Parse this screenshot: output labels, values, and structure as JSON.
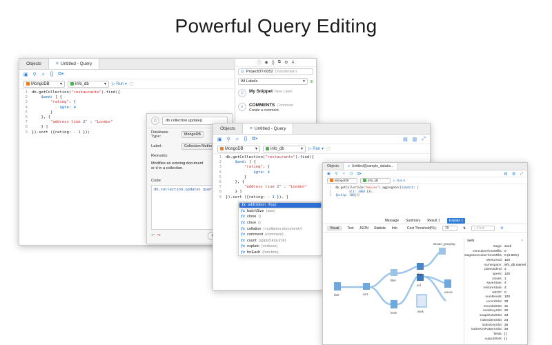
{
  "headline": "Powerful Query Editing",
  "win1": {
    "tabs": [
      "Objects",
      "Untitled - Query"
    ],
    "db_type": "MongoDB",
    "db_name": "info_db",
    "run": "Run",
    "code": [
      {
        "n": "1",
        "t": "db.getCollection(\"restaurants\").find({"
      },
      {
        "n": "2",
        "t": "    $and: [ {"
      },
      {
        "n": "3",
        "t": "        \"rating\": {"
      },
      {
        "n": "4",
        "t": "            $gte: 4"
      },
      {
        "n": "5",
        "t": "        }"
      },
      {
        "n": "6",
        "t": "    }, {"
      },
      {
        "n": "7",
        "t": "        \"address line 2\" : \"London\""
      },
      {
        "n": "8",
        "t": "    } ]"
      },
      {
        "n": "9",
        "t": "}).sort ({rating: - 1 });"
      }
    ],
    "side": {
      "project": "ProjectDT-0052",
      "project_user": "(marybrown)",
      "labels": "All Labels",
      "snippets": [
        {
          "title": "My Snippet",
          "sub": "New Label",
          "desc": ""
        },
        {
          "title": "COMMENTS",
          "sub": "Comment",
          "desc": "Create a comment."
        }
      ]
    }
  },
  "dialog": {
    "title": "db.collection.update()",
    "db_type_label": "Database Type:",
    "db_type": "MongoDB",
    "label_label": "Label:",
    "label": "Collection Metho",
    "remarks_label": "Remarks:",
    "remarks": "Modifies an existing document or d in a collection.",
    "code_label": "Code:",
    "code": "db.collection.update( query ,",
    "cancel": "Cancel"
  },
  "win2": {
    "tabs": [
      "Objects",
      "Untitled - Query"
    ],
    "db_type": "MongoDB",
    "db_name": "info_db",
    "run": "Run",
    "code": [
      {
        "n": "1",
        "t": "db.getCollection(\"restaurants\").find({"
      },
      {
        "n": "2",
        "t": "    $and: [ {"
      },
      {
        "n": "3",
        "t": "        \"rating\": {"
      },
      {
        "n": "4",
        "t": "            $gte: 4"
      },
      {
        "n": "5",
        "t": "        }"
      },
      {
        "n": "6",
        "t": "    }, {"
      },
      {
        "n": "7",
        "t": "        \"address line 2\" : \"London\""
      },
      {
        "n": "8",
        "t": "    } ]"
      },
      {
        "n": "9",
        "t": "}).sort ({rating: - 1 }). ]"
      }
    ],
    "autocomplete": [
      {
        "name": "addOption",
        "hint": "(flag)"
      },
      {
        "name": "batchSize",
        "hint": "(size)"
      },
      {
        "name": "clone",
        "hint": "()"
      },
      {
        "name": "close",
        "hint": "()"
      },
      {
        "name": "collation",
        "hint": "(<collation document>)"
      },
      {
        "name": "comment",
        "hint": "(comment)"
      },
      {
        "name": "count",
        "hint": "(applySkipLimit)"
      },
      {
        "name": "explain",
        "hint": "(verbose)"
      },
      {
        "name": "forEach",
        "hint": "(function)"
      }
    ]
  },
  "win3": {
    "tabs": [
      "Objects",
      "Untitled@sample_databa..."
    ],
    "db_type": "MongoDB",
    "db_name": "info_db",
    "run": "Run",
    "code": [
      {
        "n": "1",
        "t": "db.getCollection(\"movies\").aggregate([{$match: {"
      },
      {
        "n": "2",
        "t": "        $lt: 1960 }}},"
      },
      {
        "n": "3",
        "t": "{$skip: 100}])"
      }
    ],
    "result_tabs": [
      "Message",
      "Summary",
      "Result 1",
      "Explain 1"
    ],
    "view_tabs": [
      "Visual",
      "Text",
      "JSON",
      "Statistic",
      "Info"
    ],
    "cost_label": "Cost Threshold(%):",
    "cost_value": "70",
    "find_placeholder": "Find",
    "nodes": [
      "limit",
      "sort",
      "filter",
      "fetch",
      "skip",
      "stream_grouping",
      "ixscan",
      "eof",
      "seek"
    ],
    "stats_title": "seek",
    "stats": [
      {
        "k": "stage:",
        "v": "seek"
      },
      {
        "k": "executionTimeMillis:",
        "v": "0"
      },
      {
        "k": "stageExecutionTimeMillis:",
        "v": "0 (0.00%)"
      },
      {
        "k": "nReturned:",
        "v": "100"
      },
      {
        "k": "namespace:",
        "v": "info_db.mamel"
      },
      {
        "k": "planNodeId:",
        "v": "2"
      },
      {
        "k": "opens:",
        "v": "100"
      },
      {
        "k": "closes:",
        "v": "1"
      },
      {
        "k": "saveState:",
        "v": "4"
      },
      {
        "k": "restoreState:",
        "v": "4"
      },
      {
        "k": "isEOF:",
        "v": "0"
      },
      {
        "k": "numReads:",
        "v": "100"
      },
      {
        "k": "recordSlot:",
        "v": "30"
      },
      {
        "k": "recordIdSlot:",
        "v": "31"
      },
      {
        "k": "seekKeySlot:",
        "v": "22"
      },
      {
        "k": "snapshotIdSlot:",
        "v": "23"
      },
      {
        "k": "indexIdentSlot:",
        "v": "24"
      },
      {
        "k": "indexKeySlot:",
        "v": "25"
      },
      {
        "k": "indexKeyPatternSlot:",
        "v": "26"
      },
      {
        "k": "fields:",
        "v": "[ ]"
      },
      {
        "k": "outputSlots:",
        "v": "[ ]"
      }
    ]
  }
}
